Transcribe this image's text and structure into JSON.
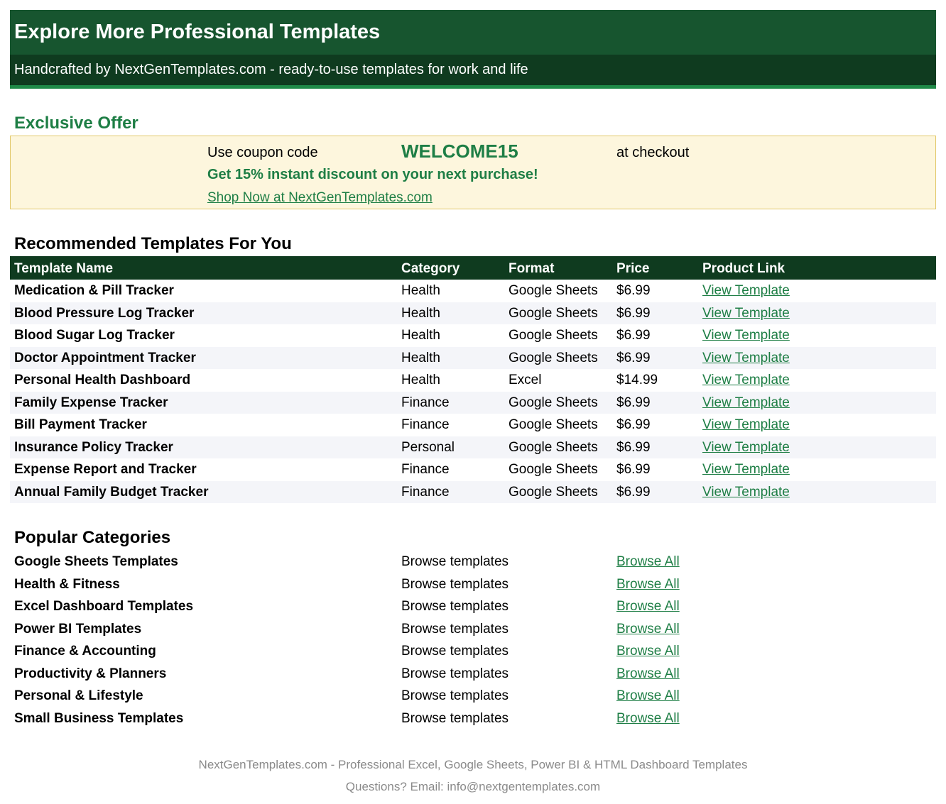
{
  "banner": {
    "title": "Explore More Professional Templates",
    "subtitle": "Handcrafted by NextGenTemplates.com - ready-to-use templates for work and life",
    "colors": {
      "title_bg": "#17552f",
      "subtitle_bg": "#0f3b1f",
      "stripe": "#1f8a48"
    }
  },
  "offer": {
    "heading": "Exclusive Offer",
    "coupon_prefix": "Use coupon code",
    "coupon_code": "WELCOME15",
    "coupon_suffix": "at checkout",
    "discount": "Get 15% instant discount on your next purchase!",
    "link": "Shop Now at NextGenTemplates.com"
  },
  "recommended": {
    "title": "Recommended Templates For You",
    "headers": [
      "Template Name",
      "Category",
      "Format",
      "Price",
      "Product Link"
    ],
    "rows": [
      {
        "name": "Medication & Pill Tracker",
        "category": "Health",
        "format": "Google Sheets",
        "price": "$6.99",
        "link": "View Template"
      },
      {
        "name": "Blood Pressure Log Tracker",
        "category": "Health",
        "format": "Google Sheets",
        "price": "$6.99",
        "link": "View Template"
      },
      {
        "name": "Blood Sugar Log Tracker",
        "category": "Health",
        "format": "Google Sheets",
        "price": "$6.99",
        "link": "View Template"
      },
      {
        "name": "Doctor Appointment Tracker",
        "category": "Health",
        "format": "Google Sheets",
        "price": "$6.99",
        "link": "View Template"
      },
      {
        "name": "Personal Health Dashboard",
        "category": "Health",
        "format": "Excel",
        "price": "$14.99",
        "link": "View Template"
      },
      {
        "name": "Family Expense Tracker",
        "category": "Finance",
        "format": "Google Sheets",
        "price": "$6.99",
        "link": "View Template"
      },
      {
        "name": "Bill Payment Tracker",
        "category": "Finance",
        "format": "Google Sheets",
        "price": "$6.99",
        "link": "View Template"
      },
      {
        "name": "Insurance Policy Tracker",
        "category": "Personal",
        "format": "Google Sheets",
        "price": "$6.99",
        "link": "View Template"
      },
      {
        "name": "Expense Report and Tracker",
        "category": "Finance",
        "format": "Google Sheets",
        "price": "$6.99",
        "link": "View Template"
      },
      {
        "name": "Annual Family Budget Tracker",
        "category": "Finance",
        "format": "Google Sheets",
        "price": "$6.99",
        "link": "View Template"
      }
    ]
  },
  "categories": {
    "title": "Popular Categories",
    "rows": [
      {
        "name": "Google Sheets Templates",
        "desc": "Browse templates",
        "link": "Browse All"
      },
      {
        "name": "Health & Fitness",
        "desc": "Browse templates",
        "link": "Browse All"
      },
      {
        "name": "Excel Dashboard Templates",
        "desc": "Browse templates",
        "link": "Browse All"
      },
      {
        "name": "Power BI Templates",
        "desc": "Browse templates",
        "link": "Browse All"
      },
      {
        "name": "Finance & Accounting",
        "desc": "Browse templates",
        "link": "Browse All"
      },
      {
        "name": "Productivity & Planners",
        "desc": "Browse templates",
        "link": "Browse All"
      },
      {
        "name": "Personal & Lifestyle",
        "desc": "Browse templates",
        "link": "Browse All"
      },
      {
        "name": "Small Business Templates",
        "desc": "Browse templates",
        "link": "Browse All"
      }
    ]
  },
  "footer": {
    "line1": "NextGenTemplates.com - Professional Excel, Google Sheets, Power BI & HTML Dashboard Templates",
    "line2": "Questions? Email: info@nextgentemplates.com"
  }
}
